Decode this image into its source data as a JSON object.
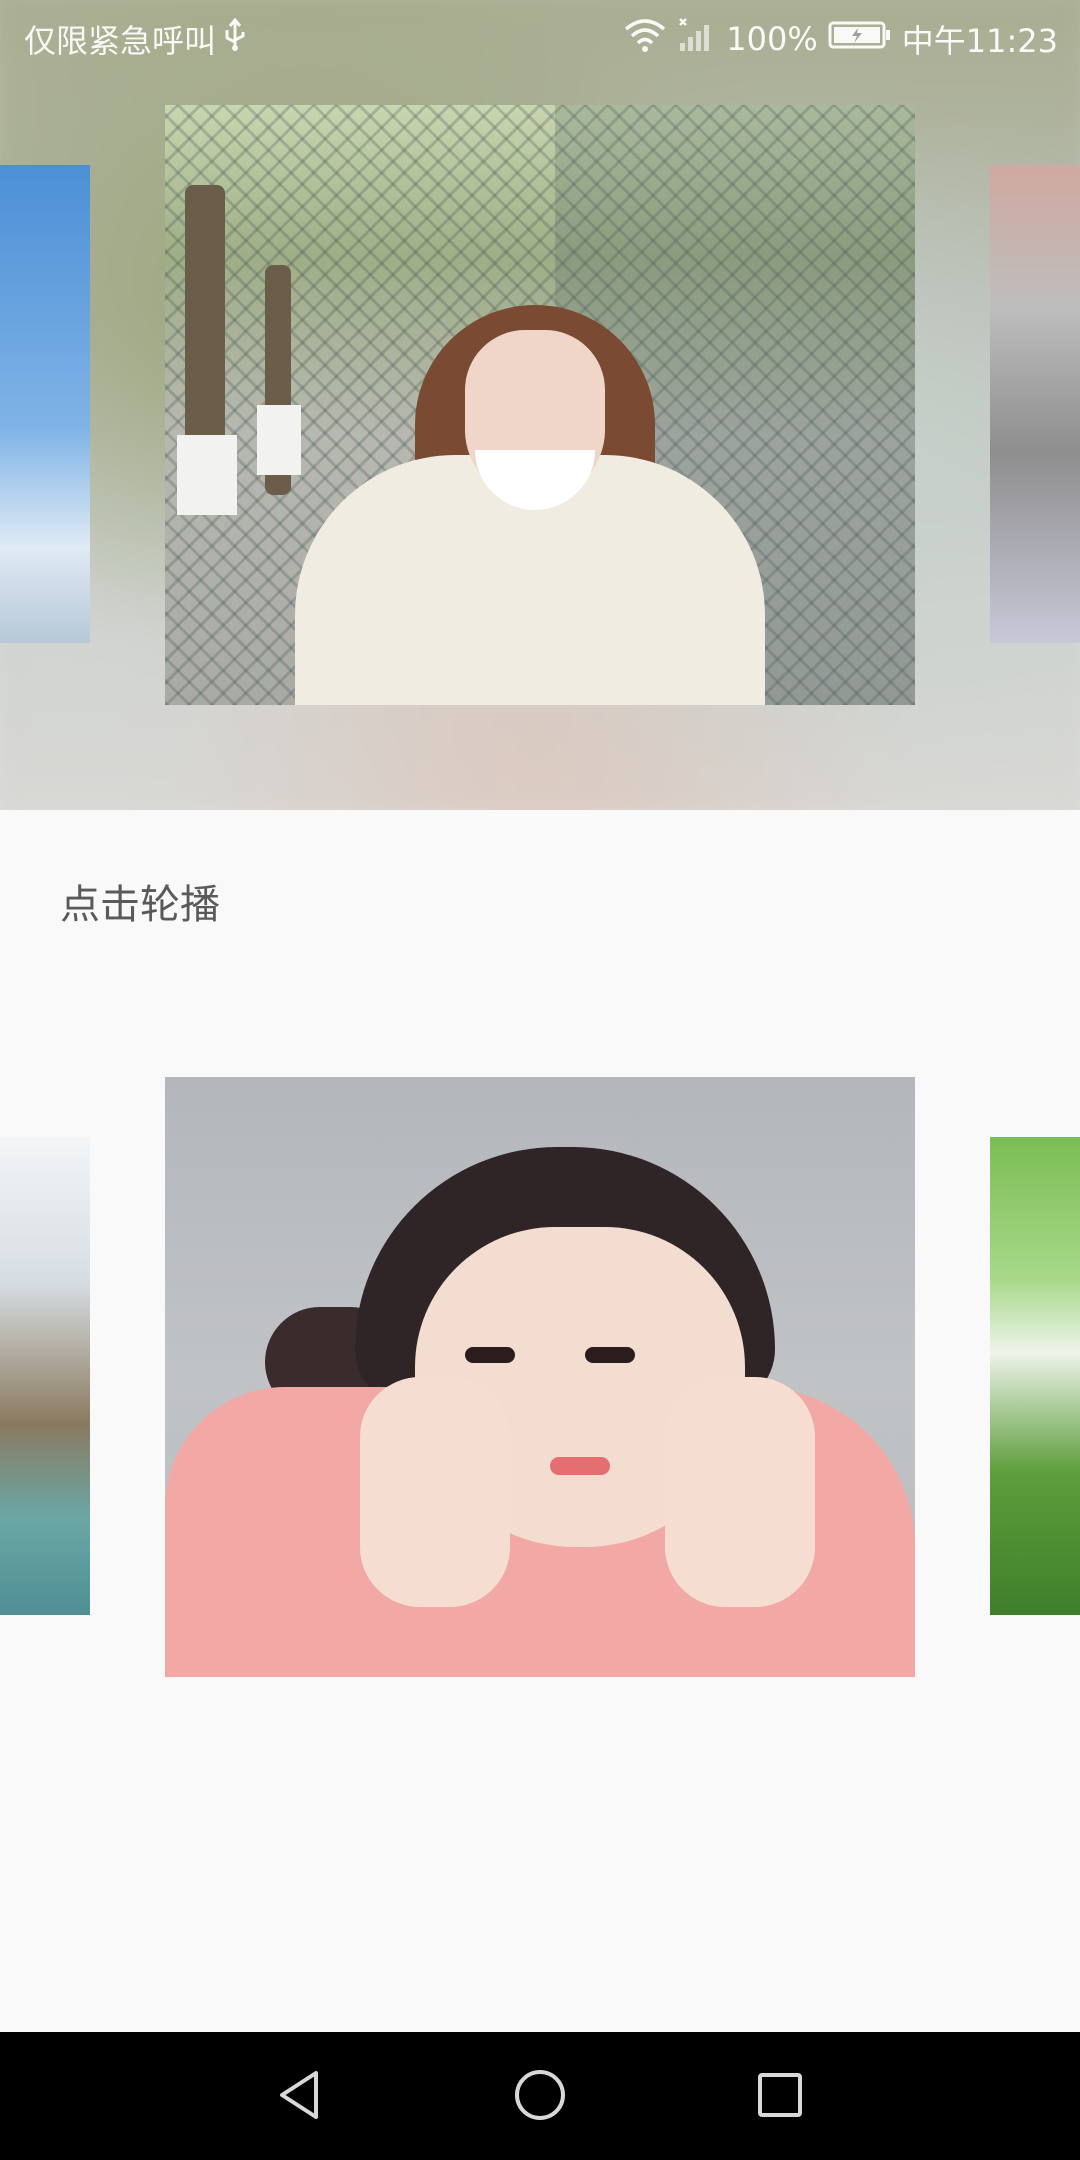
{
  "status_bar": {
    "carrier_text": "仅限紧急呼叫",
    "battery_percent": "100%",
    "time": "中午11:23",
    "icons": [
      "usb-icon",
      "wifi-icon",
      "signal-icon",
      "battery-charging-icon"
    ]
  },
  "main": {
    "label": "点击轮播"
  },
  "top_carousel": {
    "slides": [
      "side-left",
      "main",
      "side-right"
    ]
  },
  "bottom_carousel": {
    "slides": [
      "side-left",
      "main",
      "side-right"
    ]
  },
  "nav_bar": {
    "icons": [
      "back-icon",
      "home-icon",
      "recents-icon"
    ]
  },
  "colors": {
    "background": "#f9f9f9",
    "label_text": "#5a5a5a",
    "nav_background": "#000000"
  }
}
